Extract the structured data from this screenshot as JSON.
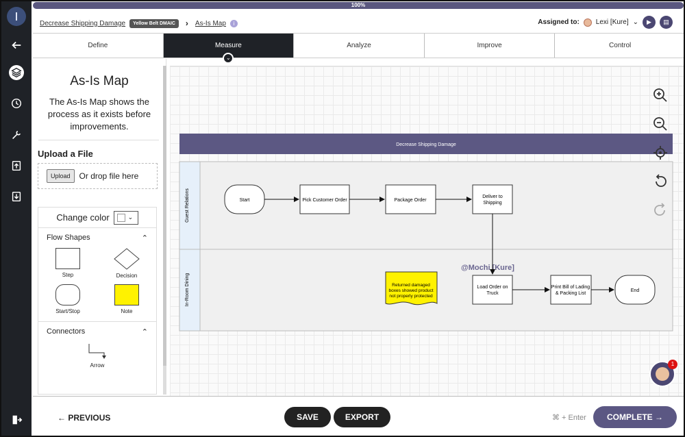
{
  "progress": {
    "label": "100%"
  },
  "breadcrumb": {
    "project": "Decrease Shipping Damage",
    "badge": "Yellow Belt DMAIC",
    "current": "As-Is Map"
  },
  "header": {
    "assigned_label": "Assigned to:",
    "assignee": "Lexi [Kure]"
  },
  "tabs": [
    "Define",
    "Measure",
    "Analyze",
    "Improve",
    "Control"
  ],
  "sidebar": {
    "title": "As-Is Map",
    "description": "The As-Is Map shows the process as it exists before improvements.",
    "upload_heading": "Upload a File",
    "upload_button": "Upload",
    "upload_hint": "Or drop file here",
    "change_color": "Change color",
    "flow_shapes_heading": "Flow Shapes",
    "shapes": [
      "Step",
      "Decision",
      "Start/Stop",
      "Note"
    ],
    "connectors_heading": "Connectors",
    "connector": "Arrow"
  },
  "diagram": {
    "title": "Decrease Shipping Damage",
    "lanes": [
      "Guest Relations",
      "In-Room Dining"
    ],
    "nodes": {
      "start": "Start",
      "pick": "Pick Customer Order",
      "package": "Package Order",
      "deliver": [
        "Deliver to",
        "Shipping"
      ],
      "load": [
        "Load Order on",
        "Truck"
      ],
      "bill": [
        "Print Bill of Lading",
        "& Packing List"
      ],
      "end": "End",
      "note": [
        "Returned damaged",
        "boxes showed product",
        "not properly protected"
      ]
    },
    "cursor_label": "@Mochi [Kure]"
  },
  "notification_count": "1",
  "footer": {
    "previous": "PREVIOUS",
    "save": "SAVE",
    "export": "EXPORT",
    "shortcut": "⌘ + Enter",
    "complete": "COMPLETE"
  }
}
